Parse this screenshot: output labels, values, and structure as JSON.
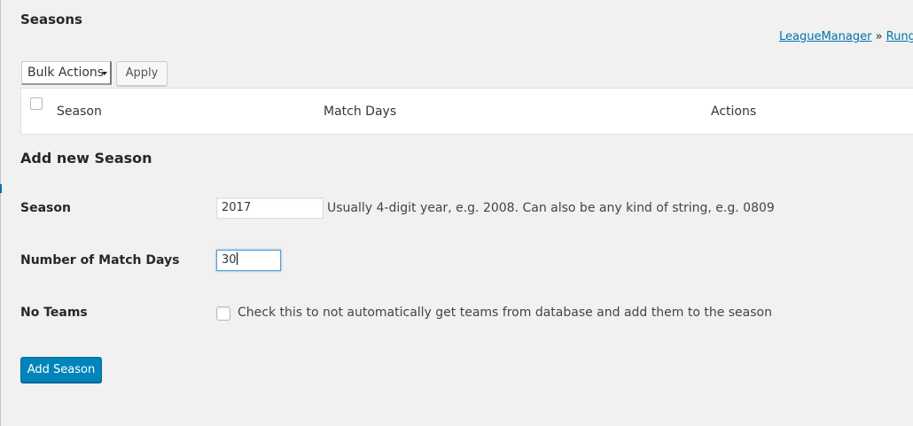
{
  "header": {
    "title": "Seasons",
    "breadcrumb": {
      "link1": "LeagueManager",
      "separator": " » ",
      "link2": "Rungkut"
    }
  },
  "bulk": {
    "select_value": "Bulk Actions",
    "apply_label": "Apply"
  },
  "table": {
    "columns": [
      "Season",
      "Match Days",
      "Actions"
    ]
  },
  "form": {
    "title": "Add new Season",
    "season": {
      "label": "Season",
      "value": "2017",
      "description": "Usually 4-digit year, e.g. 2008. Can also be any kind of string, e.g. 0809"
    },
    "match_days": {
      "label": "Number of Match Days",
      "value": "30"
    },
    "no_teams": {
      "label": "No Teams",
      "description": "Check this to not automatically get teams from database and add them to the season",
      "checked": false
    },
    "submit_label": "Add Season"
  },
  "colors": {
    "primary": "#0085ba",
    "link": "#0073aa",
    "background": "#f1f1f1"
  }
}
